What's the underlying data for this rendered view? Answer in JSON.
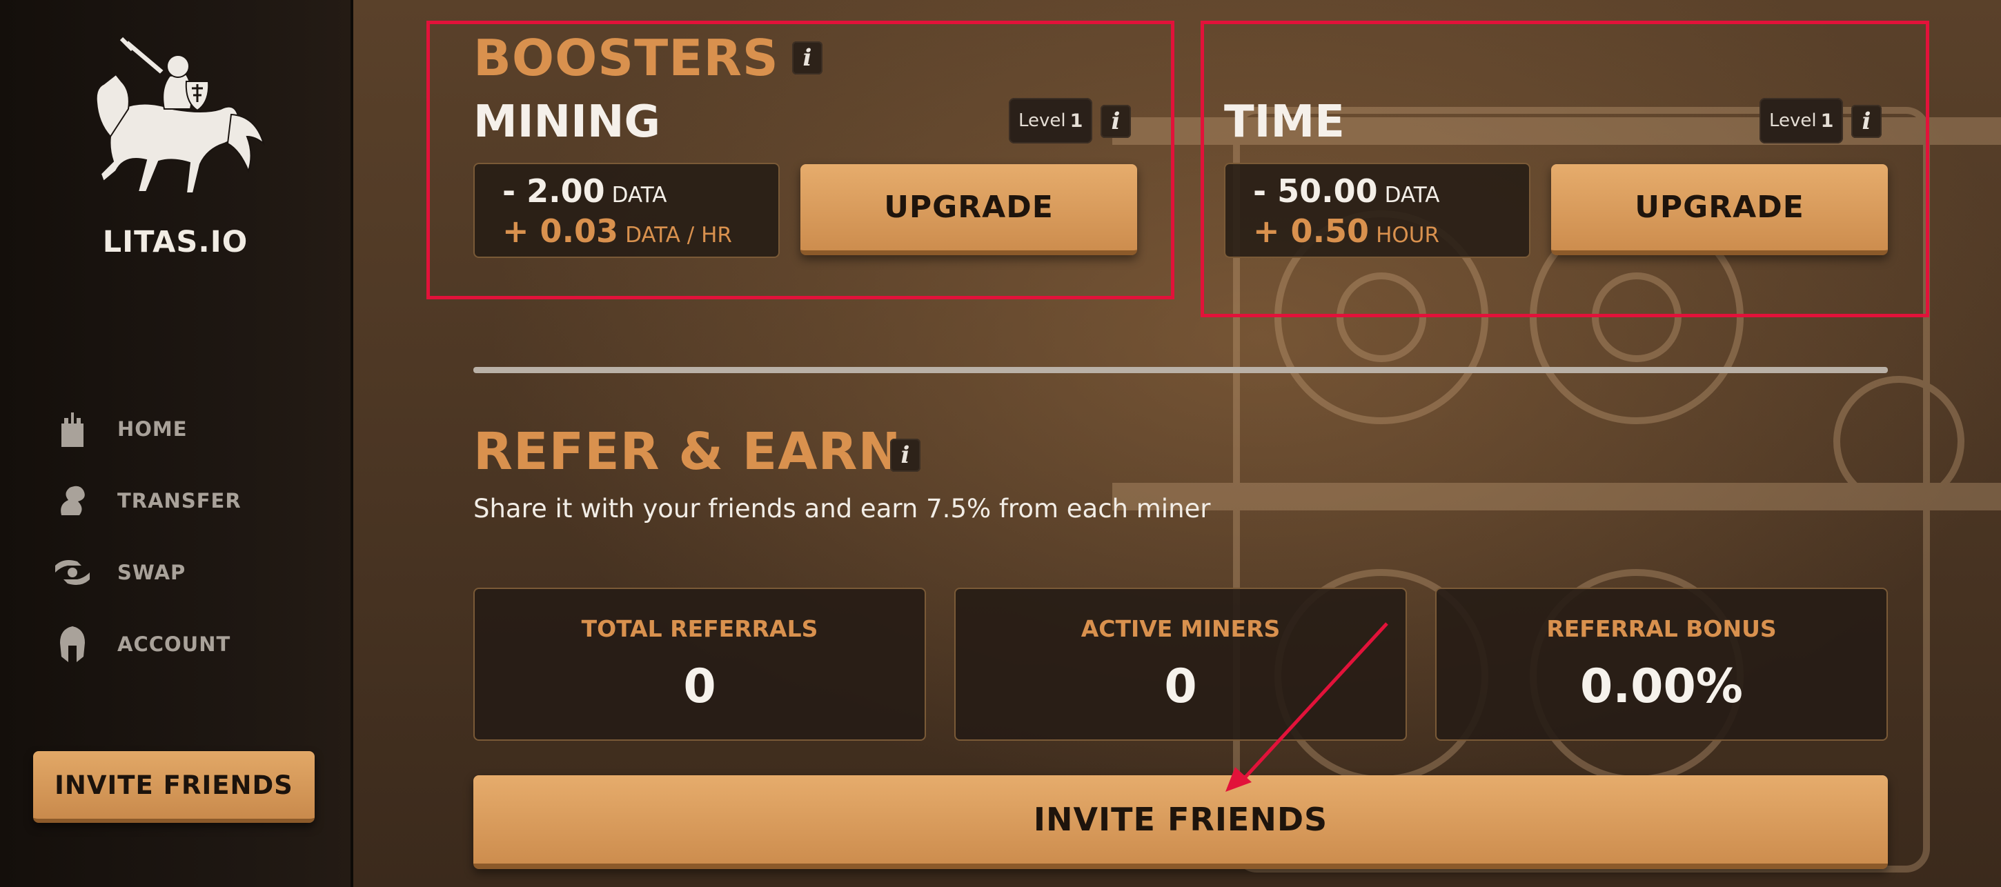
{
  "sidebar": {
    "brand": "LITAS.IO",
    "items": [
      {
        "label": "HOME",
        "icon": "castle-icon"
      },
      {
        "label": "TRANSFER",
        "icon": "transfer-icon"
      },
      {
        "label": "SWAP",
        "icon": "swap-icon"
      },
      {
        "label": "ACCOUNT",
        "icon": "helmet-icon"
      }
    ],
    "invite_label": "INVITE FRIENDS"
  },
  "boosters": {
    "title": "BOOSTERS",
    "info": "i",
    "mining": {
      "title": "MINING",
      "level_label": "Level",
      "level": "1",
      "cost": "- 2.00",
      "cost_unit": "DATA",
      "gain": "+ 0.03",
      "gain_unit": "DATA / HR",
      "upgrade_label": "UPGRADE"
    },
    "time": {
      "title": "TIME",
      "level_label": "Level",
      "level": "1",
      "cost": "- 50.00",
      "cost_unit": "DATA",
      "gain": "+ 0.50",
      "gain_unit": "HOUR",
      "upgrade_label": "UPGRADE"
    }
  },
  "refer": {
    "title": "REFER & EARN",
    "info": "i",
    "description": "Share it with your friends and earn 7.5% from each miner",
    "cards": [
      {
        "label": "TOTAL REFERRALS",
        "value": "0"
      },
      {
        "label": "ACTIVE MINERS",
        "value": "0"
      },
      {
        "label": "REFERRAL BONUS",
        "value": "0.00%"
      }
    ],
    "invite_label": "INVITE FRIENDS"
  },
  "colors": {
    "accent": "#d9914e",
    "button": "#cd8d4e",
    "highlight": "#e2123a"
  }
}
